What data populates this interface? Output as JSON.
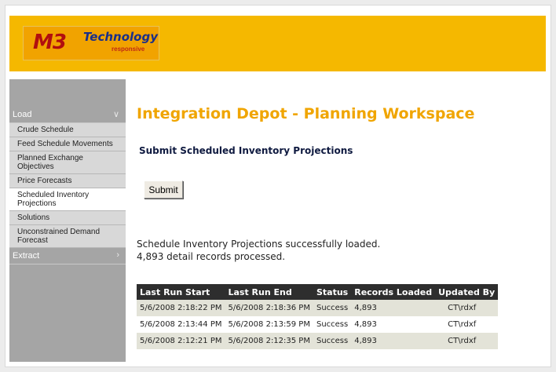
{
  "brand": {
    "logo_main": "M3",
    "logo_sub": "Technology",
    "logo_tag": "responsive"
  },
  "sidebar": {
    "sections": [
      {
        "label": "Load",
        "icon": "chevron-down-icon",
        "items": [
          {
            "label": "Crude Schedule",
            "active": false
          },
          {
            "label": "Feed Schedule Movements",
            "active": false
          },
          {
            "label": "Planned Exchange Objectives",
            "active": false
          },
          {
            "label": "Price Forecasts",
            "active": false
          },
          {
            "label": "Scheduled Inventory Projections",
            "active": true
          },
          {
            "label": "Solutions",
            "active": false
          },
          {
            "label": "Unconstrained Demand Forecast",
            "active": false
          }
        ]
      },
      {
        "label": "Extract",
        "icon": "chevron-right-icon",
        "items": []
      }
    ]
  },
  "main": {
    "title": "Integration Depot - Planning Workspace",
    "subtitle": "Submit Scheduled Inventory Projections",
    "submit_label": "Submit",
    "message_line1": "Schedule Inventory Projections successfully loaded.",
    "message_line2": "4,893 detail records processed.",
    "table": {
      "headers": [
        "Last Run Start",
        "Last Run End",
        "Status",
        "Records Loaded",
        "Updated By"
      ],
      "rows": [
        [
          "5/6/2008 2:18:22 PM",
          "5/6/2008 2:18:36 PM",
          "Success",
          "4,893",
          "CT\\rdxf"
        ],
        [
          "5/6/2008 2:13:44 PM",
          "5/6/2008 2:13:59 PM",
          "Success",
          "4,893",
          "CT\\rdxf"
        ],
        [
          "5/6/2008 2:12:21 PM",
          "5/6/2008 2:12:35 PM",
          "Success",
          "4,893",
          "CT\\rdxf"
        ]
      ]
    }
  },
  "colors": {
    "header": "#f5b800",
    "title": "#f0a500",
    "sidebar": "#a5a5a5",
    "table_header": "#2e2e2e"
  }
}
